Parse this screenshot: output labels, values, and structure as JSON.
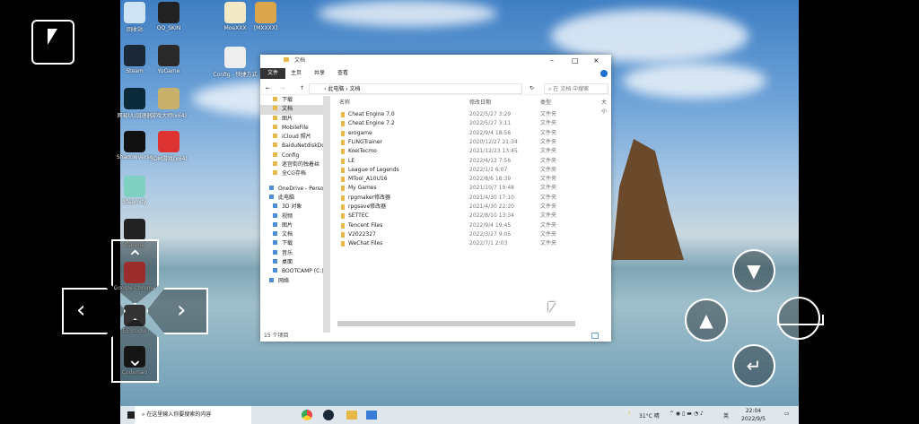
{
  "desktop": {
    "icons": [
      {
        "label": "回收站",
        "color": "#cfe3f3"
      },
      {
        "label": "QQ_SKIN",
        "color": "#222"
      },
      {
        "label": "MoeXXX",
        "color": "#f3e9c6"
      },
      {
        "label": "[MXXXX]",
        "color": "#d9a64c"
      },
      {
        "label": "Steam",
        "color": "#1b2838"
      },
      {
        "label": "YuGame",
        "color": "#2a2a2a"
      },
      {
        "label": "Config - 快捷方式",
        "color": "#eee"
      },
      {
        "label": "网易UU加速器",
        "color": "#0c2b3a"
      },
      {
        "label": "游戏大师(x64)",
        "color": "#c9b06a"
      },
      {
        "label": "Shadowverse",
        "color": "#111"
      },
      {
        "label": "3DM游戏(x64)",
        "color": "#d33"
      },
      {
        "label": "Steamify",
        "color": "#7fd0c0"
      },
      {
        "label": "Garena",
        "color": "#222"
      },
      {
        "label": "Google Chrome",
        "color": "#e44"
      },
      {
        "label": "5EStudio",
        "color": "#333"
      },
      {
        "label": "Codemao",
        "color": "#222"
      }
    ]
  },
  "explorer": {
    "title": "文档",
    "ribbon_tabs": [
      "文件",
      "主页",
      "共享",
      "查看"
    ],
    "breadcrumb": [
      "此电脑",
      "文档"
    ],
    "search_placeholder": "在 文档 中搜索",
    "columns": [
      "名称",
      "修改日期",
      "类型",
      "大小"
    ],
    "quick_access": [
      "下载",
      "文档",
      "图片",
      "MobileFile",
      "iCloud 照片",
      "BaiduNetdiskDownload",
      "Config",
      "迷宫街的独着丝",
      "全CG存档"
    ],
    "nav": [
      "OneDrive - Personal",
      "此电脑",
      "3D 对象",
      "视频",
      "图片",
      "文档",
      "下载",
      "音乐",
      "桌面",
      "BOOTCAMP (C:)",
      "网络"
    ],
    "files": [
      {
        "name": "Cheat Engine 7.0",
        "date": "2022/5/27 3:29",
        "type": "文件夹"
      },
      {
        "name": "Cheat Engine 7.2",
        "date": "2022/5/27 3:11",
        "type": "文件夹"
      },
      {
        "name": "erogame",
        "date": "2022/9/4 18:56",
        "type": "文件夹"
      },
      {
        "name": "FLiNGTrainer",
        "date": "2020/12/27 21:34",
        "type": "文件夹"
      },
      {
        "name": "KoeiTecmo",
        "date": "2021/12/23 13:45",
        "type": "文件夹"
      },
      {
        "name": "LE",
        "date": "2022/4/13 7:56",
        "type": "文件夹"
      },
      {
        "name": "League of Legends",
        "date": "2022/1/2 6:07",
        "type": "文件夹"
      },
      {
        "name": "MTool_A10U16",
        "date": "2022/8/6 18:39",
        "type": "文件夹"
      },
      {
        "name": "My Games",
        "date": "2021/10/7 19:48",
        "type": "文件夹"
      },
      {
        "name": "rpgmaker修改器",
        "date": "2021/4/30 17:10",
        "type": "文件夹"
      },
      {
        "name": "rpgsave修改器",
        "date": "2021/4/30 22:20",
        "type": "文件夹"
      },
      {
        "name": "SETTEC",
        "date": "2022/8/10 13:34",
        "type": "文件夹"
      },
      {
        "name": "Tencent Files",
        "date": "2022/9/4 19:45",
        "type": "文件夹"
      },
      {
        "name": "V2022327",
        "date": "2022/3/27 9:05",
        "type": "文件夹"
      },
      {
        "name": "WeChat Files",
        "date": "2022/7/1 2:03",
        "type": "文件夹"
      }
    ],
    "status": "15 个项目"
  },
  "taskbar": {
    "search_placeholder": "在这里输入你要搜索的内容",
    "weather": "31°C 晴",
    "ime": "英",
    "time": "22:04",
    "date": "2022/9/5"
  },
  "overlay": {
    "down": "▼",
    "up": "▲",
    "enter": "↵"
  }
}
